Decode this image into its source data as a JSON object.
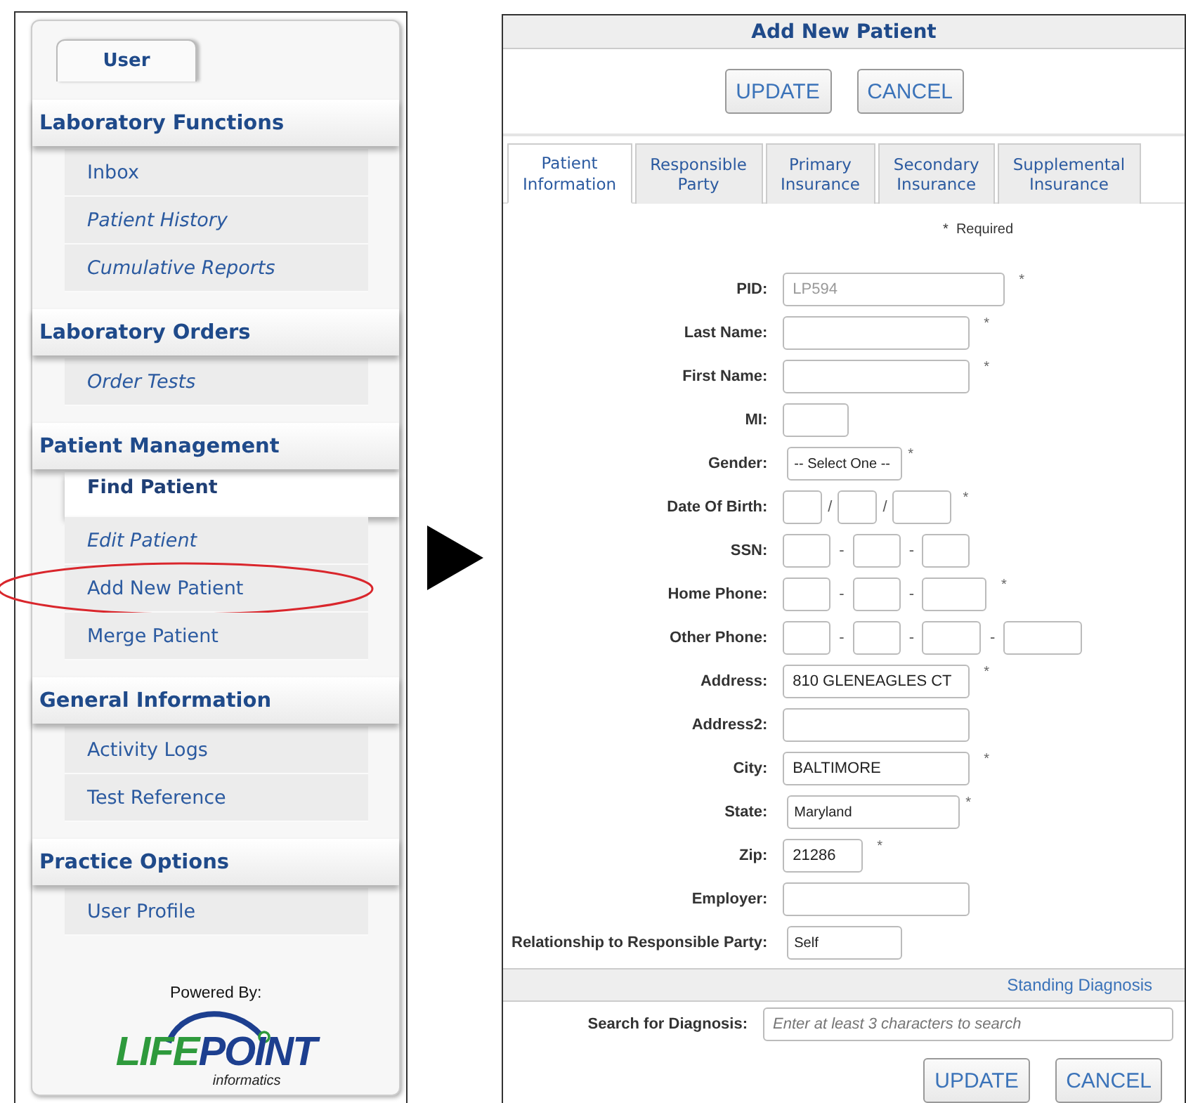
{
  "sidebar": {
    "tabs": [
      {
        "label": "User",
        "selected": true
      }
    ],
    "sections": [
      {
        "title": "Laboratory Functions",
        "items": [
          {
            "label": "Inbox",
            "kind": "normal",
            "selected": false,
            "highlighted": false
          },
          {
            "label": "Patient History",
            "kind": "italic",
            "selected": false,
            "highlighted": false
          },
          {
            "label": "Cumulative Reports",
            "kind": "italic",
            "selected": false,
            "highlighted": false
          }
        ]
      },
      {
        "title": "Laboratory Orders",
        "items": [
          {
            "label": "Order Tests",
            "kind": "italic",
            "selected": false,
            "highlighted": false
          }
        ]
      },
      {
        "title": "Patient Management",
        "items": [
          {
            "label": "Find Patient",
            "kind": "normal",
            "selected": true,
            "highlighted": false
          },
          {
            "label": "Edit Patient",
            "kind": "italic",
            "selected": false,
            "highlighted": false
          },
          {
            "label": "Add New Patient",
            "kind": "normal",
            "selected": false,
            "highlighted": true
          },
          {
            "label": "Merge Patient",
            "kind": "normal",
            "selected": false,
            "highlighted": false
          }
        ]
      },
      {
        "title": "General Information",
        "items": [
          {
            "label": "Activity Logs",
            "kind": "normal",
            "selected": false,
            "highlighted": false
          },
          {
            "label": "Test Reference",
            "kind": "normal",
            "selected": false,
            "highlighted": false
          }
        ]
      },
      {
        "title": "Practice Options",
        "items": [
          {
            "label": "User Profile",
            "kind": "normal",
            "selected": false,
            "highlighted": false
          }
        ]
      }
    ],
    "powered_by": "Powered By:",
    "logo": {
      "part_1": "LIFE",
      "part_2": "POINT",
      "tagline": "informatics"
    }
  },
  "dialog": {
    "title": "Add New Patient",
    "top_buttons": [
      "UPDATE",
      "CANCEL"
    ],
    "tabs": [
      {
        "label": "Patient Information",
        "selected": true
      },
      {
        "label": "Responsible Party",
        "selected": false
      },
      {
        "label": "Primary Insurance",
        "selected": false
      },
      {
        "label": "Secondary Insurance",
        "selected": false
      },
      {
        "label": "Supplemental Insurance",
        "selected": false
      }
    ],
    "required_note": "*  Required",
    "fields": [
      {
        "label": "PID:",
        "kind": "readonly",
        "value": "LP594",
        "mark": "*"
      },
      {
        "label": "Last Name:",
        "kind": "text",
        "mark": "*"
      },
      {
        "label": "First Name:",
        "kind": "text",
        "mark": "*"
      },
      {
        "label": "MI:",
        "kind": "short"
      },
      {
        "label": "Gender:",
        "kind": "select-short",
        "value": "-- Select One --",
        "mark": "*"
      },
      {
        "label": "Date Of Birth:",
        "kind": "date",
        "separator": "/",
        "mark": "*"
      },
      {
        "label": "SSN:",
        "kind": "ssn",
        "separator": "-"
      },
      {
        "label": "Home Phone:",
        "kind": "phone",
        "separator": "-",
        "mark": "*"
      },
      {
        "label": "Other Phone:",
        "kind": "phone-ext",
        "separator": "-"
      },
      {
        "label": "Address:",
        "kind": "text",
        "value": "810 GLENEAGLES CT",
        "mark": "*"
      },
      {
        "label": "Address2:",
        "kind": "text"
      },
      {
        "label": "City:",
        "kind": "text",
        "value": "BALTIMORE",
        "mark": "*"
      },
      {
        "label": "State:",
        "kind": "select-long",
        "value": "Maryland",
        "mark": "*"
      },
      {
        "label": "Zip:",
        "kind": "zip",
        "value": "21286",
        "mark": "*"
      },
      {
        "label": "Employer:",
        "kind": "text"
      },
      {
        "label": "Relationship to Responsible Party:",
        "kind": "select-short",
        "value": "Self"
      }
    ],
    "section_band": "Standing Diagnosis",
    "search": {
      "label": "Search for Diagnosis:",
      "placeholder": "Enter at least 3 characters to search"
    },
    "bottom_buttons": [
      "UPDATE",
      "CANCEL"
    ]
  }
}
